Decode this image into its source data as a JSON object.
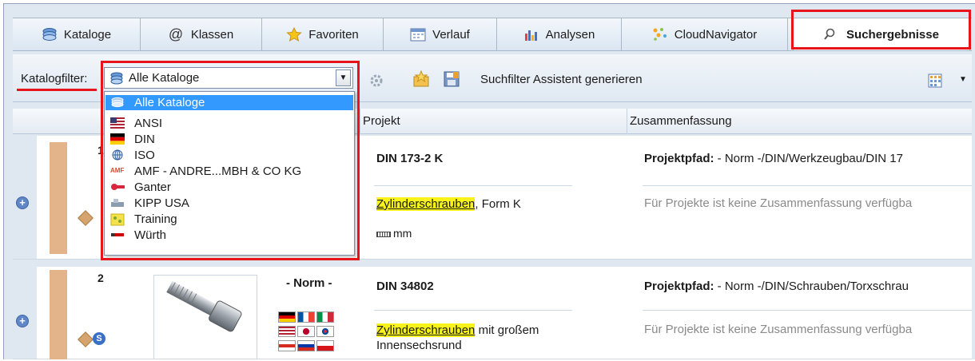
{
  "tabs": [
    {
      "label": "Kataloge",
      "icon": "catalog-stack-icon"
    },
    {
      "label": "Klassen",
      "icon": "at-sign-icon"
    },
    {
      "label": "Favoriten",
      "icon": "star-icon"
    },
    {
      "label": "Verlauf",
      "icon": "calendar-icon"
    },
    {
      "label": "Analysen",
      "icon": "bar-chart-icon"
    },
    {
      "label": "CloudNavigator",
      "icon": "cloud-dots-icon"
    },
    {
      "label": "Suchergebnisse",
      "icon": "search-icon",
      "active": true
    }
  ],
  "toolbar": {
    "filter_label": "Katalogfilter:",
    "filter_value": "Alle Kataloge",
    "suchfilter_label": "Suchfilter Assistent generieren"
  },
  "dropdown": {
    "options": [
      {
        "label": "Alle Kataloge",
        "selected": true,
        "icon": "catalog-stack-icon"
      },
      {
        "label": "ANSI",
        "icon": "us-flag-icon"
      },
      {
        "label": "DIN",
        "icon": "de-flag-icon"
      },
      {
        "label": "ISO",
        "icon": "iso-globe-icon"
      },
      {
        "label": "AMF - ANDRE...MBH & CO KG",
        "icon": "amf-logo-icon"
      },
      {
        "label": "Ganter",
        "icon": "ganter-logo-icon"
      },
      {
        "label": "KIPP USA",
        "icon": "kipp-logo-icon"
      },
      {
        "label": "Training",
        "icon": "training-icon"
      },
      {
        "label": "Würth",
        "icon": "wuerth-logo-icon"
      }
    ]
  },
  "columns": {
    "projekt": "Projekt",
    "zusammenfassung": "Zusammenfassung"
  },
  "rows": [
    {
      "num": "1",
      "project_id": "DIN 173-2 K",
      "desc_hl": "Zylinderschrauben",
      "desc_rest": ", Form K",
      "unit": "mm",
      "path_label": "Projektpfad:",
      "path_value": " - Norm -/DIN/Werkzeugbau/DIN 17",
      "summary": "Für Projekte ist keine Zusammenfassung verfügba"
    },
    {
      "num": "2",
      "norm_label": "- Norm -",
      "project_id": "DIN 34802",
      "desc_hl": "Zylinderschrauben",
      "desc_rest": " mit großem",
      "desc_line2": "Innensechsrund",
      "path_label": "Projektpfad:",
      "path_value": " - Norm -/DIN/Schrauben/Torxschrau",
      "summary": "Für Projekte ist keine Zusammenfassung verfügba"
    }
  ]
}
